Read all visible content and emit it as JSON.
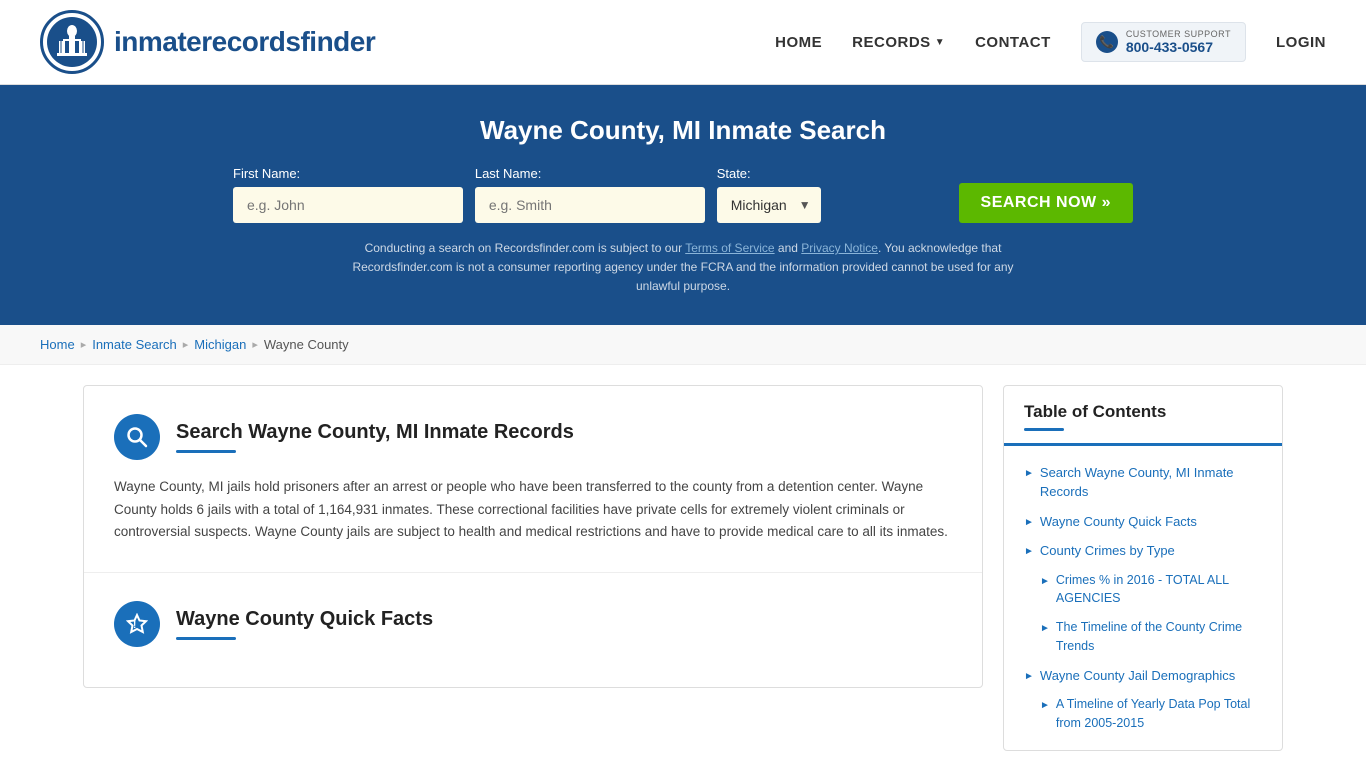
{
  "header": {
    "logo_text_regular": "inmaterecords",
    "logo_text_bold": "finder",
    "nav_home": "HOME",
    "nav_records": "RECORDS",
    "nav_contact": "CONTACT",
    "support_label": "CUSTOMER SUPPORT",
    "support_number": "800-433-0567",
    "login": "LOGIN"
  },
  "hero": {
    "title": "Wayne County, MI Inmate Search",
    "first_name_label": "First Name:",
    "first_name_placeholder": "e.g. John",
    "last_name_label": "Last Name:",
    "last_name_placeholder": "e.g. Smith",
    "state_label": "State:",
    "state_value": "Michigan",
    "search_button": "SEARCH NOW »",
    "disclaimer": "Conducting a search on Recordsfinder.com is subject to our Terms of Service and Privacy Notice. You acknowledge that Recordsfinder.com is not a consumer reporting agency under the FCRA and the information provided cannot be used for any unlawful purpose."
  },
  "breadcrumb": {
    "home": "Home",
    "inmate_search": "Inmate Search",
    "michigan": "Michigan",
    "current": "Wayne County"
  },
  "content": {
    "section1": {
      "title": "Search Wayne County, MI Inmate Records",
      "body": "Wayne County, MI jails hold prisoners after an arrest or people who have been transferred to the county from a detention center. Wayne County holds 6 jails with a total of 1,164,931 inmates. These correctional facilities have private cells for extremely violent criminals or controversial suspects. Wayne County jails are subject to health and medical restrictions and have to provide medical care to all its inmates."
    },
    "section2": {
      "title": "Wayne County Quick Facts"
    }
  },
  "toc": {
    "title": "Table of Contents",
    "items": [
      {
        "label": "Search Wayne County, MI Inmate Records",
        "sub": false
      },
      {
        "label": "Wayne County Quick Facts",
        "sub": false
      },
      {
        "label": "County Crimes by Type",
        "sub": false
      },
      {
        "label": "Crimes % in 2016 - TOTAL ALL AGENCIES",
        "sub": true
      },
      {
        "label": "The Timeline of the County Crime Trends",
        "sub": true
      },
      {
        "label": "Wayne County Jail Demographics",
        "sub": false
      },
      {
        "label": "A Timeline of Yearly Data Pop Total from 2005-2015",
        "sub": true
      }
    ]
  }
}
